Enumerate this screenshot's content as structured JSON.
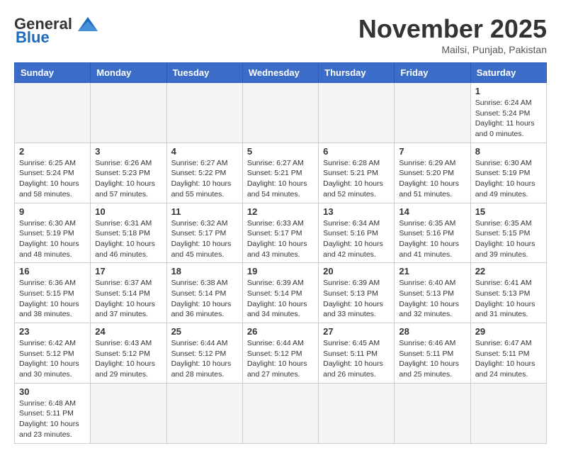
{
  "header": {
    "logo_general": "General",
    "logo_blue": "Blue",
    "month": "November 2025",
    "location": "Mailsi, Punjab, Pakistan"
  },
  "days_of_week": [
    "Sunday",
    "Monday",
    "Tuesday",
    "Wednesday",
    "Thursday",
    "Friday",
    "Saturday"
  ],
  "weeks": [
    [
      {
        "day": "",
        "empty": true
      },
      {
        "day": "",
        "empty": true
      },
      {
        "day": "",
        "empty": true
      },
      {
        "day": "",
        "empty": true
      },
      {
        "day": "",
        "empty": true
      },
      {
        "day": "",
        "empty": true
      },
      {
        "day": "1",
        "sunrise": "6:24 AM",
        "sunset": "5:24 PM",
        "daylight": "11 hours and 0 minutes."
      }
    ],
    [
      {
        "day": "2",
        "sunrise": "6:25 AM",
        "sunset": "5:24 PM",
        "daylight": "10 hours and 58 minutes."
      },
      {
        "day": "3",
        "sunrise": "6:26 AM",
        "sunset": "5:23 PM",
        "daylight": "10 hours and 57 minutes."
      },
      {
        "day": "4",
        "sunrise": "6:27 AM",
        "sunset": "5:22 PM",
        "daylight": "10 hours and 55 minutes."
      },
      {
        "day": "5",
        "sunrise": "6:27 AM",
        "sunset": "5:21 PM",
        "daylight": "10 hours and 54 minutes."
      },
      {
        "day": "6",
        "sunrise": "6:28 AM",
        "sunset": "5:21 PM",
        "daylight": "10 hours and 52 minutes."
      },
      {
        "day": "7",
        "sunrise": "6:29 AM",
        "sunset": "5:20 PM",
        "daylight": "10 hours and 51 minutes."
      },
      {
        "day": "8",
        "sunrise": "6:30 AM",
        "sunset": "5:19 PM",
        "daylight": "10 hours and 49 minutes."
      }
    ],
    [
      {
        "day": "9",
        "sunrise": "6:30 AM",
        "sunset": "5:19 PM",
        "daylight": "10 hours and 48 minutes."
      },
      {
        "day": "10",
        "sunrise": "6:31 AM",
        "sunset": "5:18 PM",
        "daylight": "10 hours and 46 minutes."
      },
      {
        "day": "11",
        "sunrise": "6:32 AM",
        "sunset": "5:17 PM",
        "daylight": "10 hours and 45 minutes."
      },
      {
        "day": "12",
        "sunrise": "6:33 AM",
        "sunset": "5:17 PM",
        "daylight": "10 hours and 43 minutes."
      },
      {
        "day": "13",
        "sunrise": "6:34 AM",
        "sunset": "5:16 PM",
        "daylight": "10 hours and 42 minutes."
      },
      {
        "day": "14",
        "sunrise": "6:35 AM",
        "sunset": "5:16 PM",
        "daylight": "10 hours and 41 minutes."
      },
      {
        "day": "15",
        "sunrise": "6:35 AM",
        "sunset": "5:15 PM",
        "daylight": "10 hours and 39 minutes."
      }
    ],
    [
      {
        "day": "16",
        "sunrise": "6:36 AM",
        "sunset": "5:15 PM",
        "daylight": "10 hours and 38 minutes."
      },
      {
        "day": "17",
        "sunrise": "6:37 AM",
        "sunset": "5:14 PM",
        "daylight": "10 hours and 37 minutes."
      },
      {
        "day": "18",
        "sunrise": "6:38 AM",
        "sunset": "5:14 PM",
        "daylight": "10 hours and 36 minutes."
      },
      {
        "day": "19",
        "sunrise": "6:39 AM",
        "sunset": "5:14 PM",
        "daylight": "10 hours and 34 minutes."
      },
      {
        "day": "20",
        "sunrise": "6:39 AM",
        "sunset": "5:13 PM",
        "daylight": "10 hours and 33 minutes."
      },
      {
        "day": "21",
        "sunrise": "6:40 AM",
        "sunset": "5:13 PM",
        "daylight": "10 hours and 32 minutes."
      },
      {
        "day": "22",
        "sunrise": "6:41 AM",
        "sunset": "5:13 PM",
        "daylight": "10 hours and 31 minutes."
      }
    ],
    [
      {
        "day": "23",
        "sunrise": "6:42 AM",
        "sunset": "5:12 PM",
        "daylight": "10 hours and 30 minutes."
      },
      {
        "day": "24",
        "sunrise": "6:43 AM",
        "sunset": "5:12 PM",
        "daylight": "10 hours and 29 minutes."
      },
      {
        "day": "25",
        "sunrise": "6:44 AM",
        "sunset": "5:12 PM",
        "daylight": "10 hours and 28 minutes."
      },
      {
        "day": "26",
        "sunrise": "6:44 AM",
        "sunset": "5:12 PM",
        "daylight": "10 hours and 27 minutes."
      },
      {
        "day": "27",
        "sunrise": "6:45 AM",
        "sunset": "5:11 PM",
        "daylight": "10 hours and 26 minutes."
      },
      {
        "day": "28",
        "sunrise": "6:46 AM",
        "sunset": "5:11 PM",
        "daylight": "10 hours and 25 minutes."
      },
      {
        "day": "29",
        "sunrise": "6:47 AM",
        "sunset": "5:11 PM",
        "daylight": "10 hours and 24 minutes."
      }
    ],
    [
      {
        "day": "30",
        "sunrise": "6:48 AM",
        "sunset": "5:11 PM",
        "daylight": "10 hours and 23 minutes."
      },
      {
        "day": "",
        "empty": true
      },
      {
        "day": "",
        "empty": true
      },
      {
        "day": "",
        "empty": true
      },
      {
        "day": "",
        "empty": true
      },
      {
        "day": "",
        "empty": true
      },
      {
        "day": "",
        "empty": true
      }
    ]
  ],
  "labels": {
    "sunrise": "Sunrise:",
    "sunset": "Sunset:",
    "daylight": "Daylight:"
  }
}
